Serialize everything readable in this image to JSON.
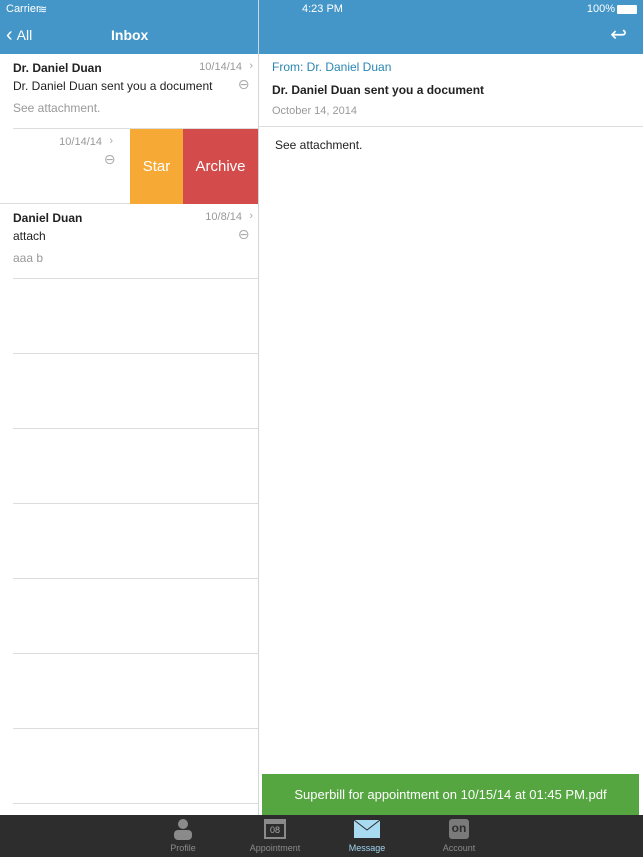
{
  "status": {
    "carrier": "Carrier",
    "time": "4:23 PM",
    "battery": "100%"
  },
  "nav": {
    "back_label": "All",
    "title": "Inbox"
  },
  "messages": [
    {
      "sender": "Dr. Daniel Duan",
      "date": "10/14/14",
      "subject": "Dr. Daniel Duan sent you a document",
      "preview": "See attachment."
    },
    {
      "date": "10/14/14",
      "star_label": "Star",
      "archive_label": "Archive"
    },
    {
      "sender": "Daniel Duan",
      "date": "10/8/14",
      "subject": "attach",
      "preview": "aaa b"
    }
  ],
  "detail": {
    "from": "From: Dr. Daniel Duan",
    "subject": "Dr. Daniel Duan sent you a document",
    "date": "October 14, 2014",
    "body": "See attachment.",
    "attachment": "Superbill for appointment on 10/15/14 at 01:45 PM.pdf"
  },
  "tabs": [
    {
      "label": "Profile"
    },
    {
      "label": "Appointment",
      "badge": "08"
    },
    {
      "label": "Message"
    },
    {
      "label": "Account",
      "badge": "on"
    }
  ],
  "colors": {
    "header": "#4596c8",
    "star": "#f6aa35",
    "archive": "#d44b4b",
    "attachment": "#55a540"
  }
}
